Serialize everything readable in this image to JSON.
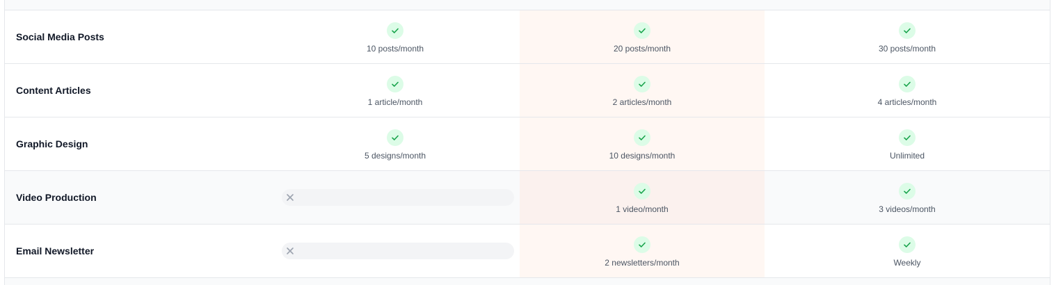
{
  "rows": [
    {
      "feature": "Social Media Posts",
      "plan_a": "10 posts/month",
      "plan_b": "20 posts/month",
      "plan_c": "30 posts/month"
    },
    {
      "feature": "Content Articles",
      "plan_a": "1 article/month",
      "plan_b": "2 articles/month",
      "plan_c": "4 articles/month"
    },
    {
      "feature": "Graphic Design",
      "plan_a": "5 designs/month",
      "plan_b": "10 designs/month",
      "plan_c": "Unlimited"
    },
    {
      "feature": "Video Production",
      "plan_a": null,
      "plan_b": "1 video/month",
      "plan_c": "3 videos/month"
    },
    {
      "feature": "Email Newsletter",
      "plan_a": null,
      "plan_b": "2 newsletters/month",
      "plan_c": "Weekly"
    }
  ],
  "icons": {
    "included": "check-icon",
    "excluded": "x-icon"
  },
  "colors": {
    "check_bg": "#dcfce7",
    "check_stroke": "#16a34a",
    "highlight_col": "#fff7f3",
    "x_color": "#9ca3af"
  }
}
